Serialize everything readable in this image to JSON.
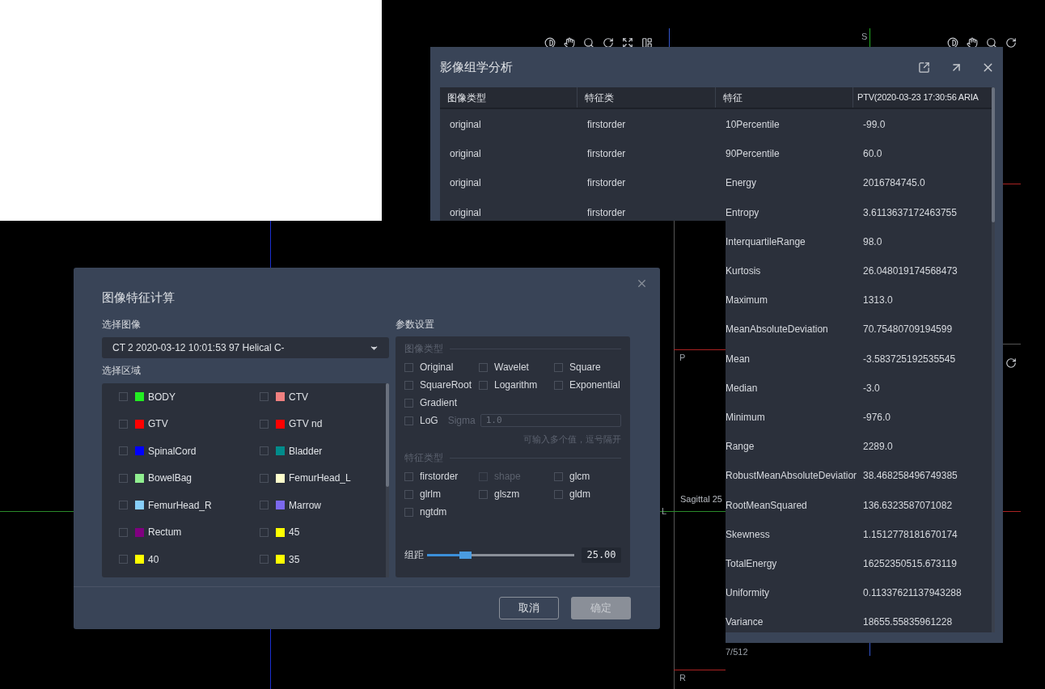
{
  "viewer": {
    "labels": [
      {
        "text": "S"
      },
      {
        "text": "P"
      },
      {
        "text": "Sagittal 25"
      },
      {
        "text": "L"
      },
      {
        "text": "7/512"
      },
      {
        "text": "R"
      }
    ]
  },
  "radiomics_dialog": {
    "title": "影像组学分析",
    "columns": [
      "图像类型",
      "特征类",
      "特征",
      "PTV(2020-03-23 17:30:56 ARIA"
    ],
    "rows": [
      {
        "image_type": "original",
        "feature_class": "firstorder",
        "feature": "10Percentile",
        "value": "-99.0"
      },
      {
        "image_type": "original",
        "feature_class": "firstorder",
        "feature": "90Percentile",
        "value": "60.0"
      },
      {
        "image_type": "original",
        "feature_class": "firstorder",
        "feature": "Energy",
        "value": "2016784745.0"
      },
      {
        "image_type": "original",
        "feature_class": "firstorder",
        "feature": "Entropy",
        "value": "3.6113637172463755"
      },
      {
        "feature": "InterquartileRange",
        "value": "98.0"
      },
      {
        "feature": "Kurtosis",
        "value": "26.048019174568473"
      },
      {
        "feature": "Maximum",
        "value": "1313.0"
      },
      {
        "feature": "MeanAbsoluteDeviation",
        "value": "70.75480709194599"
      },
      {
        "feature": "Mean",
        "value": "-3.583725192535545"
      },
      {
        "feature": "Median",
        "value": "-3.0"
      },
      {
        "feature": "Minimum",
        "value": "-976.0"
      },
      {
        "feature": "Range",
        "value": "2289.0"
      },
      {
        "feature": "RobustMeanAbsoluteDeviatior",
        "value": "38.468258496749385"
      },
      {
        "feature": "RootMeanSquared",
        "value": "136.6323587071082"
      },
      {
        "feature": "Skewness",
        "value": "1.1512778181670174"
      },
      {
        "feature": "TotalEnergy",
        "value": "16252350515.673119"
      },
      {
        "feature": "Uniformity",
        "value": "0.11337621137943288"
      },
      {
        "feature": "Variance",
        "value": "18655.55835961228"
      }
    ]
  },
  "feature_dialog": {
    "title": "图像特征计算",
    "image_label": "选择图像",
    "image_value": "CT 2 2020-03-12 10:01:53 97 Helical C-",
    "region_label": "选择区域",
    "regions": [
      {
        "name": "BODY",
        "color": "#22ee22",
        "checked": false
      },
      {
        "name": "CTV",
        "color": "#f08080",
        "checked": false
      },
      {
        "name": "GTV",
        "color": "#ff0000",
        "checked": false
      },
      {
        "name": "GTV nd",
        "color": "#ff0000",
        "checked": false
      },
      {
        "name": "SpinalCord",
        "color": "#0000ff",
        "checked": false
      },
      {
        "name": "Bladder",
        "color": "#008b8b",
        "checked": false
      },
      {
        "name": "BowelBag",
        "color": "#90ee90",
        "checked": false
      },
      {
        "name": "FemurHead_L",
        "color": "#ffffcc",
        "checked": false
      },
      {
        "name": "FemurHead_R",
        "color": "#87cefa",
        "checked": false
      },
      {
        "name": "Marrow",
        "color": "#7b68ee",
        "checked": false
      },
      {
        "name": "Rectum",
        "color": "#800080",
        "checked": false
      },
      {
        "name": "45",
        "color": "#ffff00",
        "checked": false
      },
      {
        "name": "40",
        "color": "#ffff00",
        "checked": false
      },
      {
        "name": "35",
        "color": "#ffff00",
        "checked": false
      }
    ],
    "params_label": "参数设置",
    "image_type_legend": "图像类型",
    "image_types": [
      {
        "label": "Original",
        "checked": false
      },
      {
        "label": "Wavelet",
        "checked": false
      },
      {
        "label": "Square",
        "checked": false
      },
      {
        "label": "SquareRoot",
        "checked": false
      },
      {
        "label": "Logarithm",
        "checked": false
      },
      {
        "label": "Exponential",
        "checked": false
      },
      {
        "label": "Gradient",
        "checked": false
      }
    ],
    "log": {
      "label": "LoG",
      "checked": false,
      "sigma_label": "Sigma",
      "sigma_value": "1.0"
    },
    "hint": "可输入多个值，逗号隔开",
    "feature_type_legend": "特征类型",
    "feature_types": [
      {
        "label": "firstorder",
        "checked": false,
        "disabled": false
      },
      {
        "label": "shape",
        "checked": false,
        "disabled": true
      },
      {
        "label": "glcm",
        "checked": false,
        "disabled": false
      },
      {
        "label": "glrlm",
        "checked": false,
        "disabled": false
      },
      {
        "label": "glszm",
        "checked": false,
        "disabled": false
      },
      {
        "label": "gldm",
        "checked": false,
        "disabled": false
      },
      {
        "label": "ngtdm",
        "checked": false,
        "disabled": false
      }
    ],
    "bin_size": {
      "label": "组距",
      "level": 0.26,
      "value": "25.00"
    },
    "buttons": [
      {
        "label": "取消",
        "kind": "outline",
        "disabled": false
      },
      {
        "label": "确定",
        "kind": "primary",
        "disabled": true
      }
    ]
  }
}
